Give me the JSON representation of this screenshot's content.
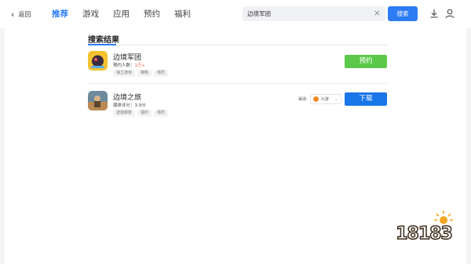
{
  "header": {
    "back_label": "返回",
    "tabs": [
      {
        "label": "推荐",
        "active": true
      },
      {
        "label": "游戏",
        "active": false
      },
      {
        "label": "应用",
        "active": false
      },
      {
        "label": "预约",
        "active": false
      },
      {
        "label": "福利",
        "active": false
      }
    ],
    "search": {
      "value": "边境军团",
      "clear_icon": "close-icon"
    },
    "search_button": "搜索",
    "icons": [
      "download-icon",
      "user-icon"
    ]
  },
  "results": {
    "section_title": "搜索结果",
    "games": [
      {
        "name": "边境军团",
        "meta_label": "预约人数：",
        "meta_value": "1万+",
        "tags": [
          "独立游戏",
          "策略",
          "塔防"
        ],
        "action": "预约",
        "action_color": "#5cc84a"
      },
      {
        "name": "边境之旅",
        "meta_label": "媒体评分：",
        "meta_value": "3.9分",
        "tags": [
          "送首服款",
          "福利",
          "塔防"
        ],
        "source_label": "渠道:",
        "source_value": "九游",
        "action": "下载",
        "action_color": "#1976e8"
      }
    ]
  },
  "watermark": {
    "text": "18183"
  },
  "colors": {
    "accent": "#2d7cf6",
    "reserve": "#5cc84a",
    "download": "#1976e8",
    "highlight": "#f5593d"
  }
}
